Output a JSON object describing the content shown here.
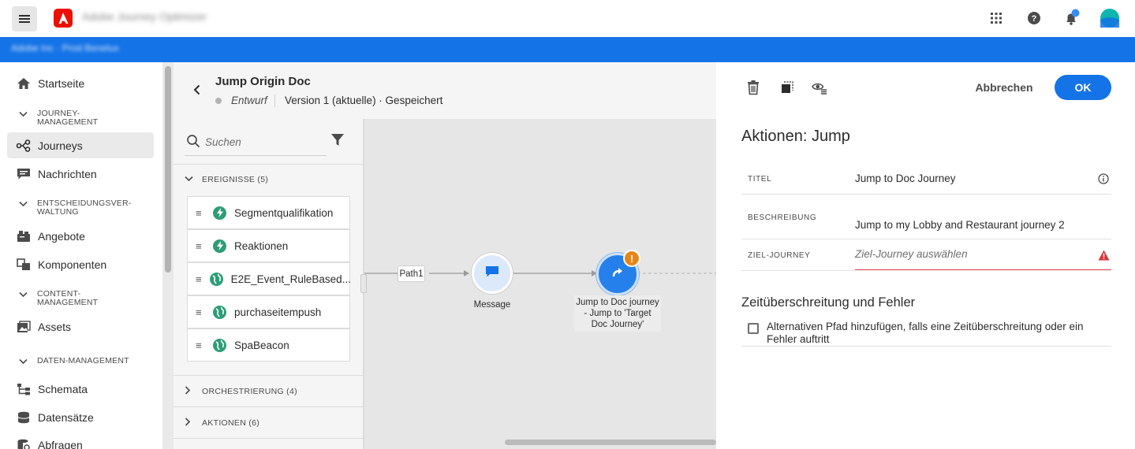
{
  "topbar": {
    "app_title": "Adobe Journey Optimizer",
    "icons": [
      "menu-icon",
      "adobe-logo",
      "apps-grid-icon",
      "help-icon",
      "notifications-icon",
      "avatar"
    ]
  },
  "bluebar": {
    "org_switcher": "Adobe Inc · Prod Benelux"
  },
  "sidebar": {
    "items": [
      {
        "type": "item",
        "label": "Startseite",
        "icon": "home-icon"
      },
      {
        "type": "section",
        "label": "JOURNEY-\nMANAGEMENT"
      },
      {
        "type": "item",
        "label": "Journeys",
        "icon": "journeys-icon",
        "selected": true
      },
      {
        "type": "item",
        "label": "Nachrichten",
        "icon": "message-icon"
      },
      {
        "type": "section",
        "label": "ENTSCHEIDUNGSVER-\nWALTUNG"
      },
      {
        "type": "item",
        "label": "Angebote",
        "icon": "offers-icon"
      },
      {
        "type": "item",
        "label": "Komponenten",
        "icon": "components-icon"
      },
      {
        "type": "section",
        "label": "CONTENT-\nMANAGEMENT"
      },
      {
        "type": "item",
        "label": "Assets",
        "icon": "assets-icon"
      },
      {
        "type": "section",
        "label": "DATEN-MANAGEMENT"
      },
      {
        "type": "item",
        "label": "Schemata",
        "icon": "schemas-icon"
      },
      {
        "type": "item",
        "label": "Datensätze",
        "icon": "datasets-icon"
      },
      {
        "type": "item",
        "label": "Abfragen",
        "icon": "queries-icon"
      }
    ]
  },
  "journey": {
    "name": "Jump Origin Doc",
    "status": "Entwurf",
    "version": "Version 1 (aktuelle) · Gespeichert"
  },
  "palette": {
    "search_placeholder": "Suchen",
    "events_header": "EREIGNISSE (5)",
    "events": [
      {
        "label": "Segmentqualifikation",
        "icon": "lightning-icon",
        "color": "#2d9d78"
      },
      {
        "label": "Reaktionen",
        "icon": "lightning-icon",
        "color": "#2d9d78"
      },
      {
        "label": "E2E_Event_RuleBased...",
        "icon": "globe-icon",
        "color": "#2d9d78"
      },
      {
        "label": "purchaseitempush",
        "icon": "globe-icon",
        "color": "#2d9d78"
      },
      {
        "label": "SpaBeacon",
        "icon": "globe-icon",
        "color": "#2d9d78"
      }
    ],
    "orchestration_header": "ORCHESTRIERUNG (4)",
    "actions_header": "AKTIONEN (6)"
  },
  "canvas": {
    "path_label": "Path1",
    "message_node_label": "Message",
    "jump_node_label": "Jump to Doc journey - Jump to 'Target Doc Journey'",
    "warning_badge": "!"
  },
  "panel": {
    "cancel_label": "Abbrechen",
    "ok_label": "OK",
    "title": "Aktionen: Jump",
    "fields": {
      "title_label": "TITEL",
      "title_value": "Jump to Doc Journey",
      "description_label": "BESCHREIBUNG",
      "description_value": "Jump to my Lobby and Restaurant journey 2",
      "target_label": "ZIEL-JOURNEY",
      "target_placeholder": "Ziel-Journey auswählen"
    },
    "timeout_section_title": "Zeitüberschreitung und Fehler",
    "timeout_checkbox_label": "Alternativen Pfad hinzufügen, falls eine Zeitüberschreitung oder ein Fehler auftritt",
    "timeout_checked": false
  },
  "colors": {
    "accent": "#1473e6",
    "error": "#d7373f",
    "warning": "#e68619",
    "event_green": "#2d9d78",
    "adobe_red": "#eb1000"
  }
}
